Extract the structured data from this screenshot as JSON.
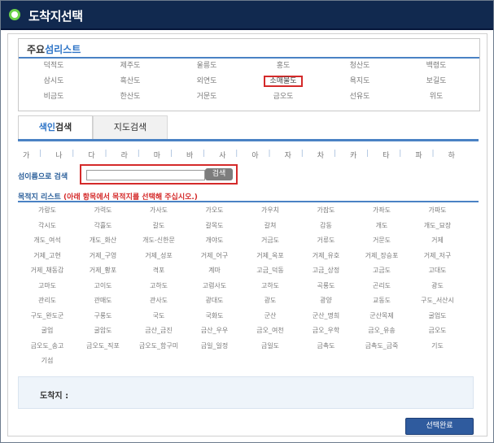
{
  "window": {
    "title": "도착지선택"
  },
  "major_islands": {
    "title_part1": "주요",
    "title_part2": "섬리스트",
    "rows": [
      [
        "덕적도",
        "제주도",
        "울릉도",
        "홍도",
        "청산도",
        "백령도"
      ],
      [
        "삼시도",
        "흑산도",
        "외연도",
        "소매물도",
        "욕지도",
        "보길도"
      ],
      [
        "비금도",
        "한산도",
        "거문도",
        "금오도",
        "선유도",
        "위도"
      ]
    ],
    "selected": "소매물도"
  },
  "tabs": {
    "index_part1": "색인",
    "index_part2": "검색",
    "map": "지도검색"
  },
  "consonants": [
    "가",
    "나",
    "다",
    "라",
    "마",
    "바",
    "사",
    "아",
    "자",
    "차",
    "카",
    "타",
    "파",
    "하"
  ],
  "search": {
    "label": "섬이름으로 검색",
    "input_value": "",
    "button": "검색"
  },
  "destinations": {
    "title": "목적지 리스트",
    "hint": "(아래 항목에서 목적지를 선택해 주십시오.)",
    "items": [
      "가랑도",
      "가력도",
      "가사도",
      "가오도",
      "가우치",
      "가잠도",
      "가좌도",
      "가파도",
      "각시도",
      "각흘도",
      "갈도",
      "갈목도",
      "갈쳐",
      "감동",
      "개도",
      "개도_묘장",
      "개도_여석",
      "개도_화산",
      "개도-신한문",
      "개야도",
      "거금도",
      "거류도",
      "거문도",
      "거제",
      "거제_고현",
      "거제_구영",
      "거제_성포",
      "거제_어구",
      "거제_옥포",
      "거제_유호",
      "거제_장승포",
      "거제_저구",
      "거제_채동감",
      "거제_황포",
      "격포",
      "계마",
      "고금_덕동",
      "고금_상정",
      "고금도",
      "고대도",
      "고마도",
      "고이도",
      "고하도",
      "고렴사도",
      "고하도",
      "곡룡도",
      "곤리도",
      "광도",
      "관리도",
      "관매도",
      "관사도",
      "광대도",
      "광도",
      "광양",
      "교동도",
      "구도_서산시",
      "구도_완도군",
      "구룡도",
      "국도",
      "국화도",
      "군산",
      "군산_명희",
      "군산목제",
      "굴업도",
      "굴업",
      "굴암도",
      "금산_금진",
      "금산_우우",
      "금오_여천",
      "금오_우학",
      "금오_유송",
      "금오도",
      "금오도_송고",
      "금오도_직포",
      "금오도_함구미",
      "금일_일정",
      "금일도",
      "금촉도",
      "금촉도_금죽",
      "기도",
      "기섬"
    ]
  },
  "destination_box": {
    "label": "도착지 :"
  },
  "done_button": {
    "label": "선택완료"
  }
}
